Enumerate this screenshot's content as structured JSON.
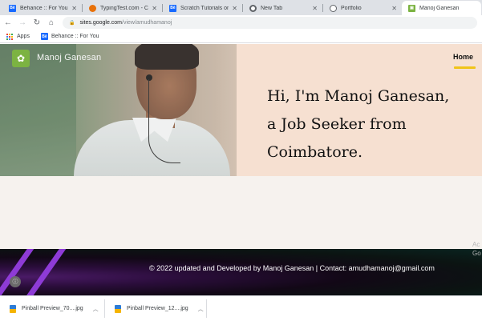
{
  "browser": {
    "tabs": [
      {
        "title": "Behance :: For You",
        "icon": "behance-icon",
        "color": "#1769ff",
        "active": false
      },
      {
        "title": "TypingTest.com - Com",
        "icon": "typingtest-icon",
        "color": "#e8710a",
        "active": false
      },
      {
        "title": "Scratch Tutorials on B",
        "icon": "behance-icon",
        "color": "#1769ff",
        "active": false
      },
      {
        "title": "New Tab",
        "icon": "chrome-icon",
        "color": "#5f6368",
        "active": false
      },
      {
        "title": "Portfolio",
        "icon": "globe-icon",
        "color": "#5f6368",
        "active": false
      },
      {
        "title": "Manoj Ganesan",
        "icon": "google-sites-icon",
        "color": "#7cb342",
        "active": true
      }
    ],
    "address": {
      "host": "sites.google.com",
      "path": "/view/amudhamanoj"
    },
    "bookmarks": {
      "apps_label": "Apps",
      "behance_label": "Behance :: For You"
    }
  },
  "site": {
    "name": "Manoj Ganesan",
    "nav_home": "Home",
    "accent": "#f0c419",
    "headline_lines": [
      "Hi, I'm Manoj Ganesan,",
      "a Job Seeker from",
      "Coimbatore."
    ],
    "footer_text": "©  2022 updated and Developed by Manoj Ganesan | Contact: amudhamanoj@gmail.com",
    "watermark_lines": [
      "Ac",
      "Go"
    ]
  },
  "downloads": [
    {
      "filename": "Pinball Preview_70....jpg"
    },
    {
      "filename": "Pinball Preview_12....jpg"
    }
  ]
}
